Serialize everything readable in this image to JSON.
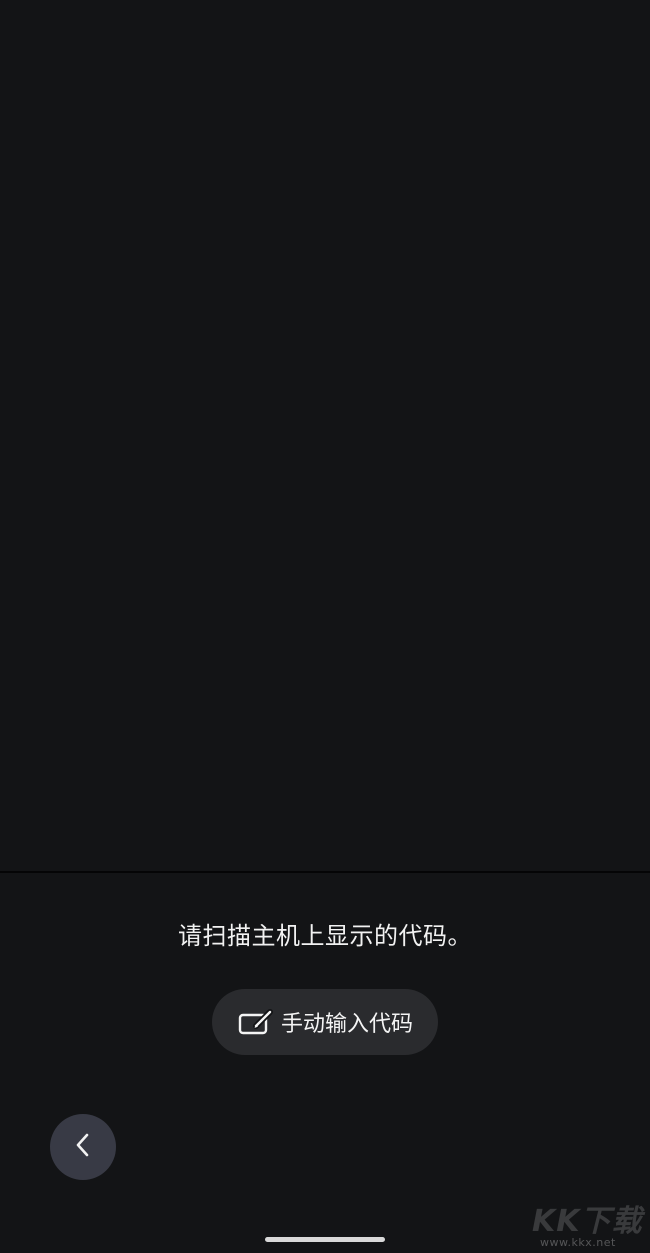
{
  "instruction": "请扫描主机上显示的代码。",
  "manual_entry": {
    "label": "手动输入代码",
    "icon": "edit-icon"
  },
  "back_button": {
    "icon": "chevron-left-icon"
  },
  "watermark": {
    "logo": "KK下载",
    "url": "www.kkx.net"
  }
}
